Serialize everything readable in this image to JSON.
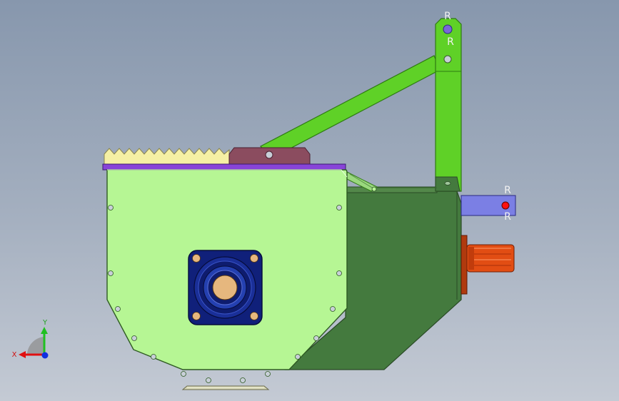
{
  "triad": {
    "x_label": "X",
    "y_label": "Y",
    "x_color": "#e01010",
    "y_color": "#20c020",
    "z_color": "#1030e0"
  },
  "pins": {
    "top_label": "R",
    "right_label": "R"
  },
  "colors": {
    "housing_light": "#b6f694",
    "housing_dark": "#447a3e",
    "arm_green": "#5fd127",
    "bracket_maroon": "#8b4c5f",
    "top_plate_purple": "#8844d8",
    "tooth_yellow": "#f5f0a4",
    "bearing_blue": "#10207a",
    "bearing_core": "#e6b77e",
    "shaft_orange": "#e24d13",
    "link_bar_lavender": "#7b7fe4",
    "pin_red": "#ff1010"
  }
}
